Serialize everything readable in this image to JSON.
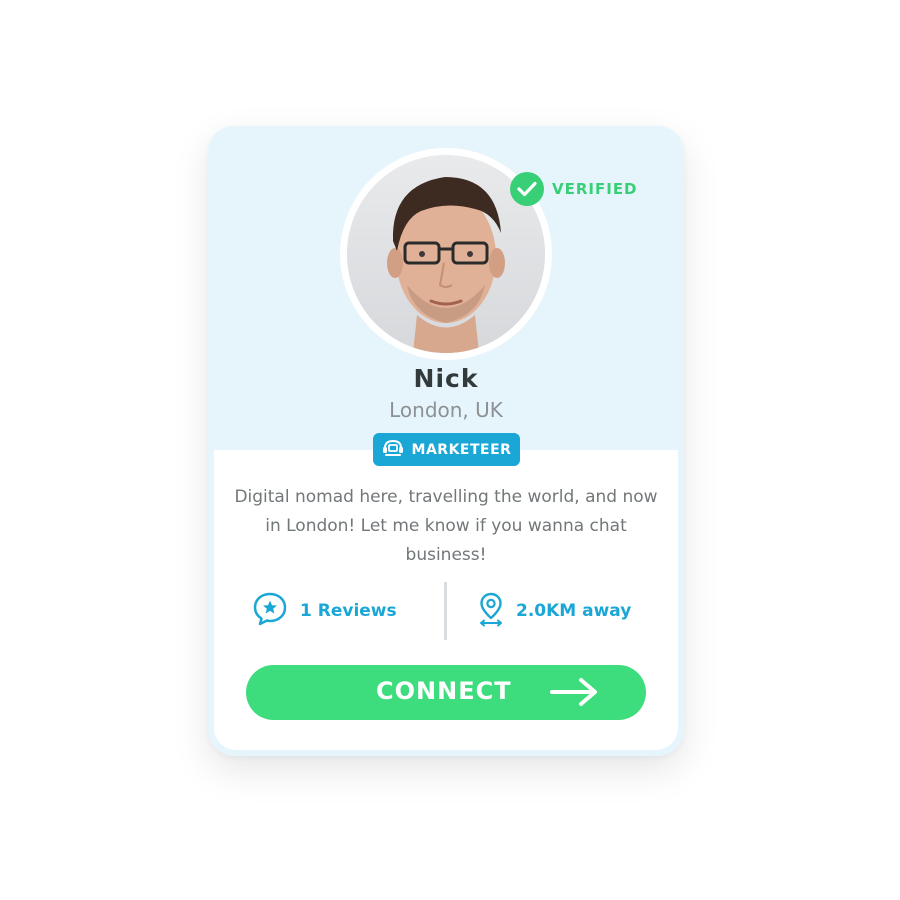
{
  "profile": {
    "name": "Nick",
    "location": "London, UK",
    "verified_label": "VERIFIED",
    "badge_label": "MARKETEER",
    "bio": "Digital nomad here, travelling the world, and now in  London! Let me know if you wanna chat business!"
  },
  "stats": {
    "reviews_label": "1 Reviews",
    "distance_label": "2.0KM away"
  },
  "actions": {
    "connect_label": "CONNECT"
  },
  "icons": {
    "verified": "check-circle-icon",
    "badge": "marketeer-icon",
    "reviews": "chat-star-icon",
    "distance": "location-pin-icon",
    "connect": "arrow-right-icon"
  },
  "colors": {
    "accent_blue": "#1aa7d6",
    "success_green": "#38cf76",
    "button_green": "#3ddc7c",
    "card_header_bg": "#e6f5fc"
  }
}
